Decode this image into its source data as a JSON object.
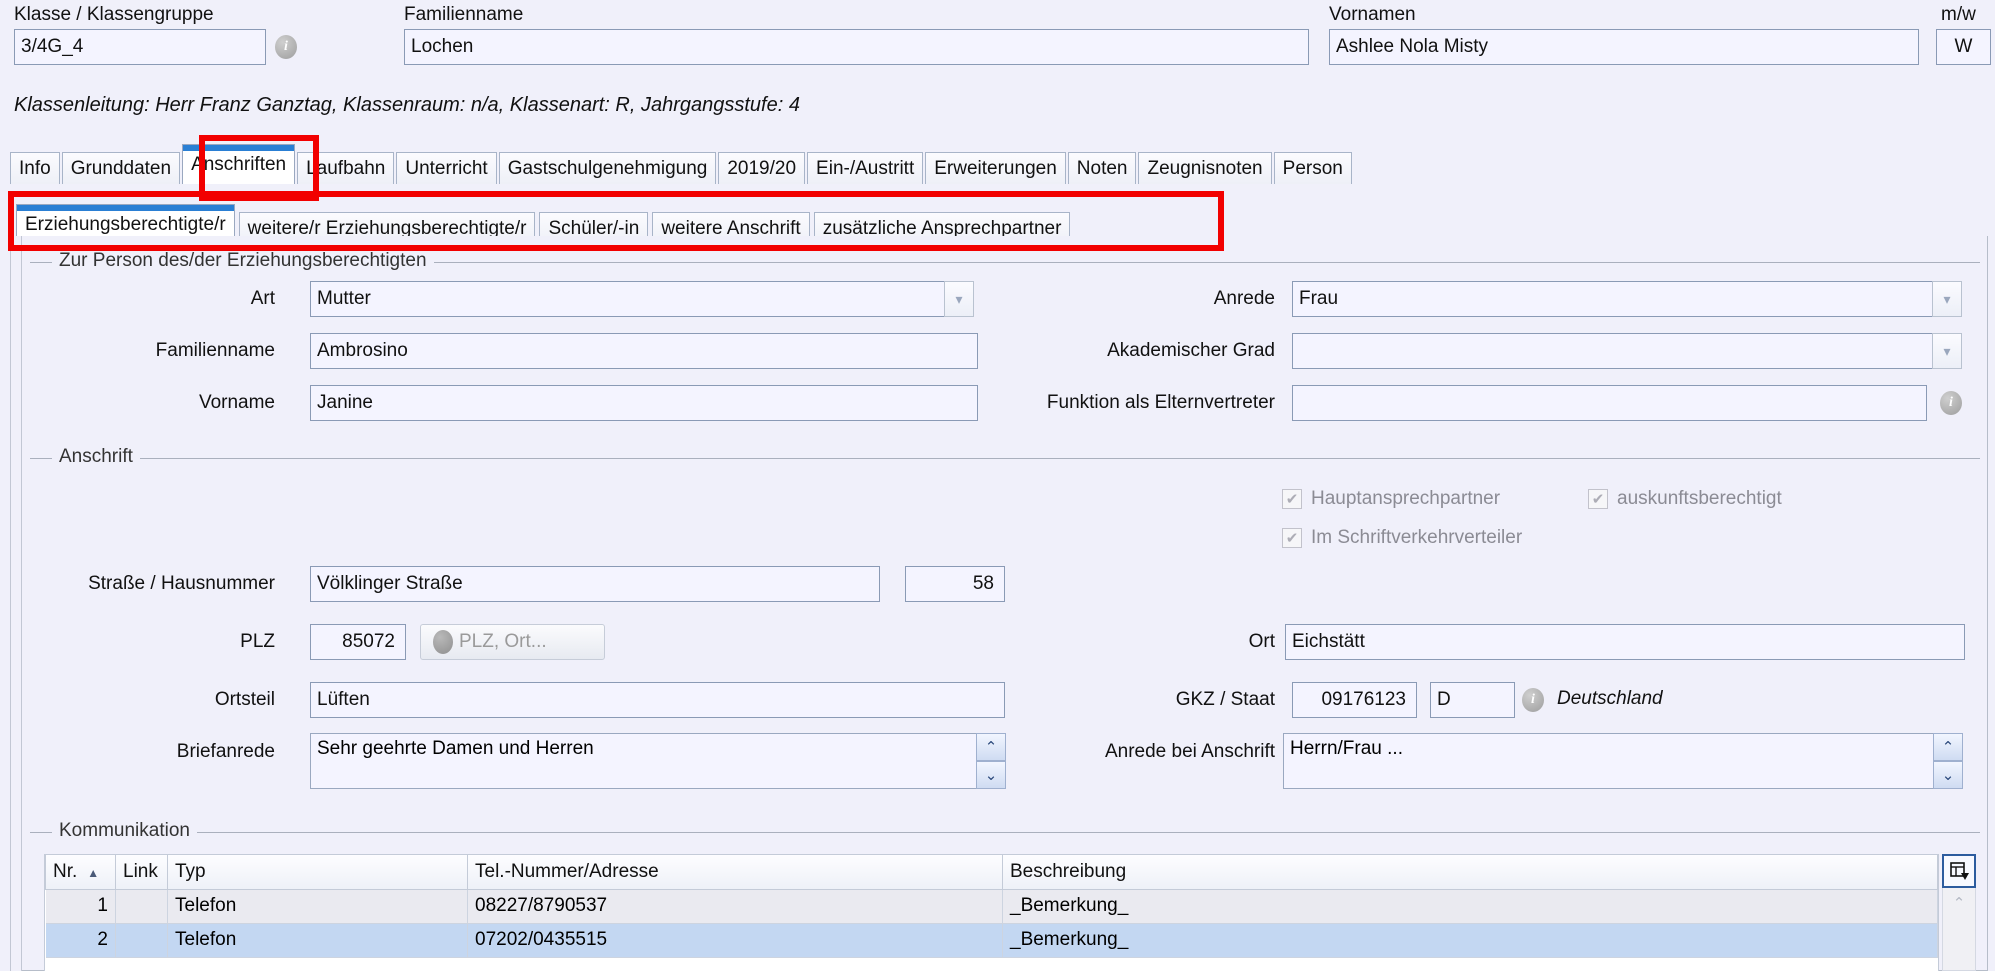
{
  "header": {
    "klasse_label": "Klasse / Klassengruppe",
    "klasse_value": "3/4G_4",
    "familienname_label": "Familienname",
    "familienname_value": "Lochen",
    "vornamen_label": "Vornamen",
    "vornamen_value": "Ashlee Nola Misty",
    "gender_label": "m/w",
    "gender_value": "W",
    "info_icon": "info-icon",
    "subline": "Klassenleitung: Herr Franz Ganztag, Klassenraum: n/a, Klassenart: R, Jahrgangsstufe: 4"
  },
  "main_tabs": [
    {
      "label": "Info",
      "active": false
    },
    {
      "label": "Grunddaten",
      "active": false
    },
    {
      "label": "Anschriften",
      "active": true
    },
    {
      "label": "Laufbahn",
      "active": false
    },
    {
      "label": "Unterricht",
      "active": false
    },
    {
      "label": "Gastschulgenehmigung",
      "active": false
    },
    {
      "label": "2019/20",
      "active": false
    },
    {
      "label": "Ein-/Austritt",
      "active": false
    },
    {
      "label": "Erweiterungen",
      "active": false
    },
    {
      "label": "Noten",
      "active": false
    },
    {
      "label": "Zeugnisnoten",
      "active": false
    },
    {
      "label": "Person",
      "active": false
    }
  ],
  "sub_tabs": [
    {
      "label": "Erziehungsberechtigte/r",
      "active": true
    },
    {
      "label": "weitere/r Erziehungsberechtigte/r",
      "active": false
    },
    {
      "label": "Schüler/-in",
      "active": false
    },
    {
      "label": "weitere Anschrift",
      "active": false
    },
    {
      "label": "zusätzliche Ansprechpartner",
      "active": false
    }
  ],
  "person_group": {
    "title": "Zur Person des/der Erziehungsberechtigten",
    "art_label": "Art",
    "art_value": "Mutter",
    "familienname_label": "Familienname",
    "familienname_value": "Ambrosino",
    "vorname_label": "Vorname",
    "vorname_value": "Janine",
    "anrede_label": "Anrede",
    "anrede_value": "Frau",
    "grad_label": "Akademischer Grad",
    "grad_value": "",
    "funktion_label": "Funktion als Elternvertreter",
    "funktion_value": ""
  },
  "anschrift_group": {
    "title": "Anschrift",
    "checkboxes": [
      {
        "label": "Hauptansprechpartner",
        "checked": true,
        "disabled": true
      },
      {
        "label": "auskunftsberechtigt",
        "checked": true,
        "disabled": true
      },
      {
        "label": "Im Schriftverkehrverteiler",
        "checked": true,
        "disabled": true
      }
    ],
    "strasse_label": "Straße / Hausnummer",
    "strasse_value": "Völklinger Straße",
    "hausnummer_value": "58",
    "plz_label": "PLZ",
    "plz_value": "85072",
    "plz_button_label": "PLZ, Ort...",
    "ort_label": "Ort",
    "ort_value": "Eichstätt",
    "ortsteil_label": "Ortsteil",
    "ortsteil_value": "Lüften",
    "gkz_label": "GKZ / Staat",
    "gkz_value": "09176123",
    "staat_value": "D",
    "staat_name": "Deutschland",
    "briefanrede_label": "Briefanrede",
    "briefanrede_value": "Sehr geehrte Damen und Herren",
    "anrede_anschrift_label": "Anrede bei Anschrift",
    "anrede_anschrift_value": "Herrn/Frau ..."
  },
  "kommunikation": {
    "title": "Kommunikation",
    "columns": [
      "Nr.",
      "Link",
      "Typ",
      "Tel.-Nummer/Adresse",
      "Beschreibung"
    ],
    "sort_indicator": "▲",
    "rows": [
      {
        "nr": "1",
        "link": "",
        "typ": "Telefon",
        "nummer": "08227/8790537",
        "beschreibung": "_Bemerkung_",
        "selected": false
      },
      {
        "nr": "2",
        "link": "",
        "typ": "Telefon",
        "nummer": "07202/0435515",
        "beschreibung": "_Bemerkung_",
        "selected": true
      }
    ],
    "grid_button_icon": "table-settings-icon",
    "scroll_up_icon": "chevron-up-icon"
  },
  "colors": {
    "accent": "#2a7fd4",
    "annotation": "#f20000",
    "field_bg": "#f4f4ff",
    "page_bg": "#f0f0fa",
    "selected_row": "#c3d7f2"
  }
}
